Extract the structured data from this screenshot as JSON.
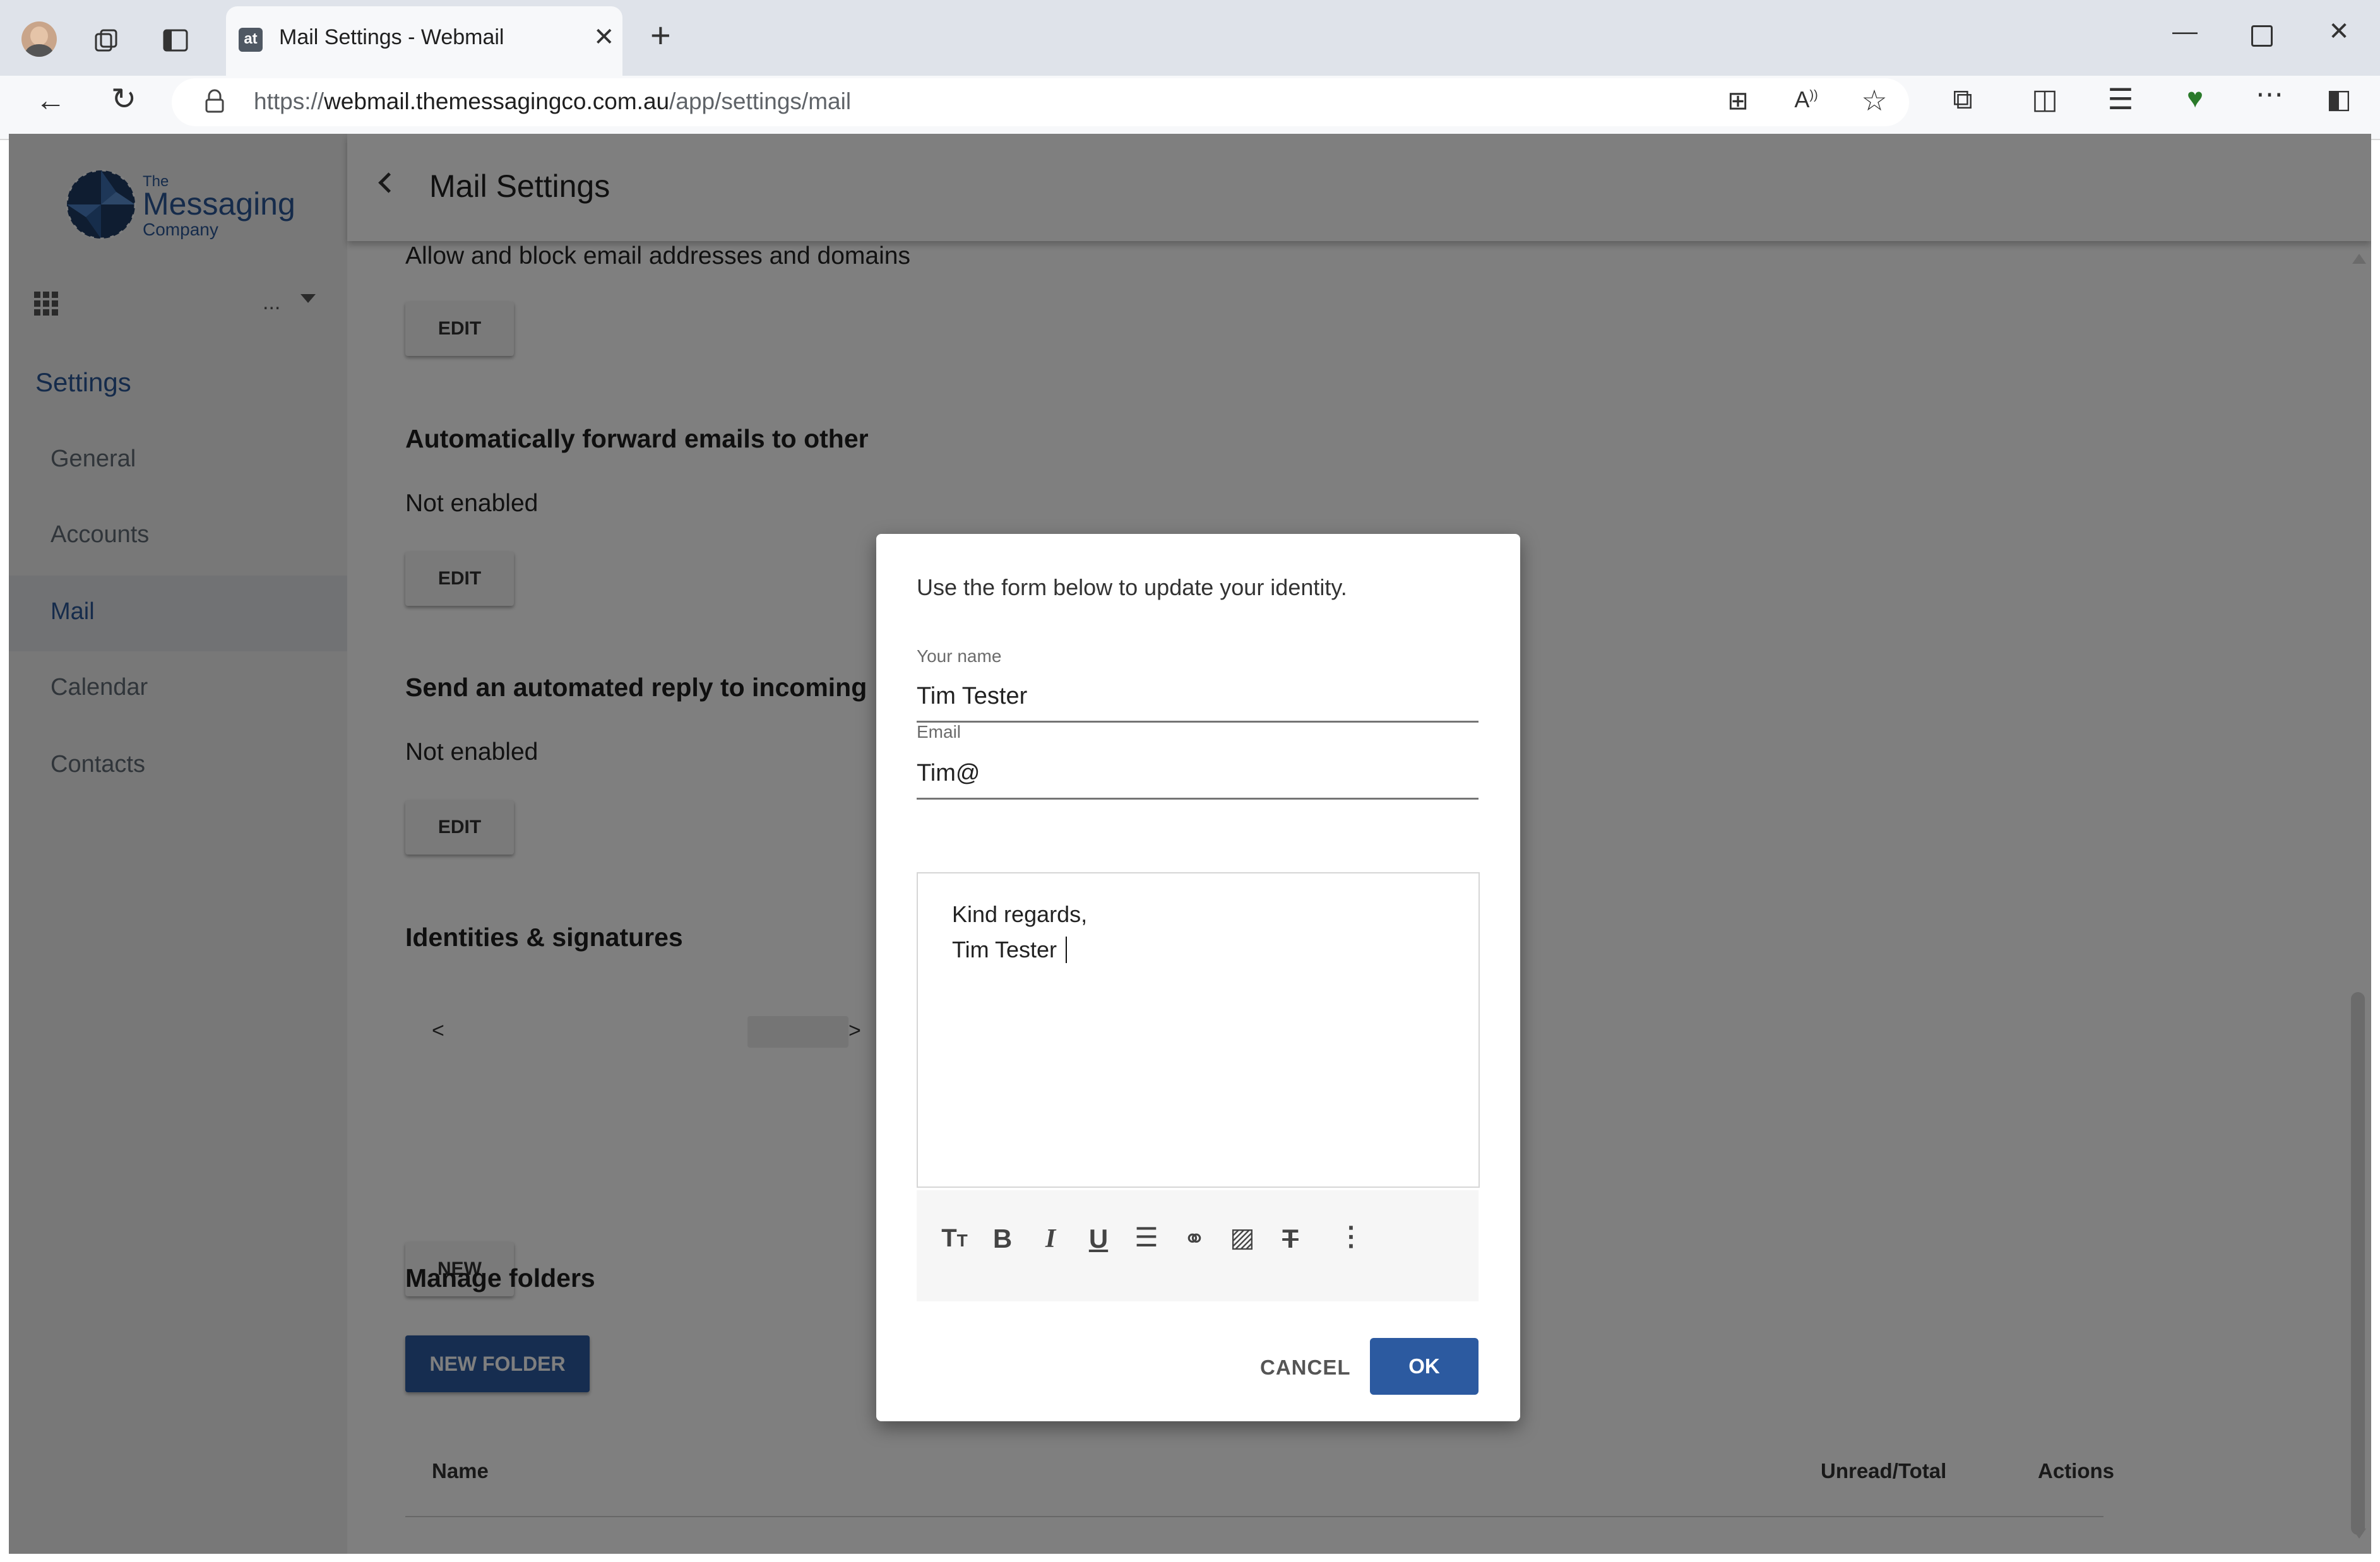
{
  "browser": {
    "tab_title": "Mail Settings - Webmail",
    "tab_favicon_text": "at",
    "url_scheme": "https://",
    "url_host": "webmail.themessagingco.com.au",
    "url_path": "/app/settings/mail",
    "icons": [
      "profile-avatar-icon",
      "workspaces-icon",
      "tab-actions-icon",
      "new-tab-icon",
      "minimize-icon",
      "maximize-icon",
      "close-window-icon",
      "back-icon",
      "refresh-icon",
      "lock-icon",
      "app-available-icon",
      "read-aloud-icon",
      "favorite-star-icon",
      "extensions-icon",
      "split-screen-icon",
      "favorites-icon",
      "browser-essentials-icon",
      "more-icon",
      "sidebar-toggle-icon"
    ]
  },
  "sidebar": {
    "logo_line1": "The",
    "logo_line2": "Messaging",
    "logo_line3": "Company",
    "account_placeholder": "...",
    "settings_heading": "Settings",
    "items": [
      {
        "label": "General"
      },
      {
        "label": "Accounts"
      },
      {
        "label": "Mail"
      },
      {
        "label": "Calendar"
      },
      {
        "label": "Contacts"
      }
    ],
    "active_item": "Mail"
  },
  "header": {
    "title": "Mail Settings"
  },
  "main": {
    "allow_block_text": "Allow and block email addresses and domains",
    "edit_label": "EDIT",
    "forward_title": "Automatically forward emails to other",
    "forward_status": "Not enabled",
    "autoreply_title": "Send an automated reply to incoming",
    "autoreply_status": "Not enabled",
    "identities_title": "Identities & signatures",
    "carousel_prev": "<",
    "carousel_next": ">",
    "new_label": "NEW",
    "folders_title": "Manage folders",
    "new_folder_label": "NEW FOLDER",
    "table_headers": [
      "Name",
      "Unread/Total",
      "Actions"
    ]
  },
  "dialog": {
    "intro": "Use the form below to update your identity.",
    "name_label": "Your name",
    "name_value": "Tim Tester",
    "email_label": "Email",
    "email_value": "Tim@",
    "signature_line1": "Kind regards,",
    "signature_line2": "Tim Tester",
    "cancel_label": "CANCEL",
    "ok_label": "OK"
  },
  "colors": {
    "accent": "#2c5aa0",
    "settings_heading": "#2b5797",
    "overlay": "rgba(0,0,0,0.5)"
  }
}
